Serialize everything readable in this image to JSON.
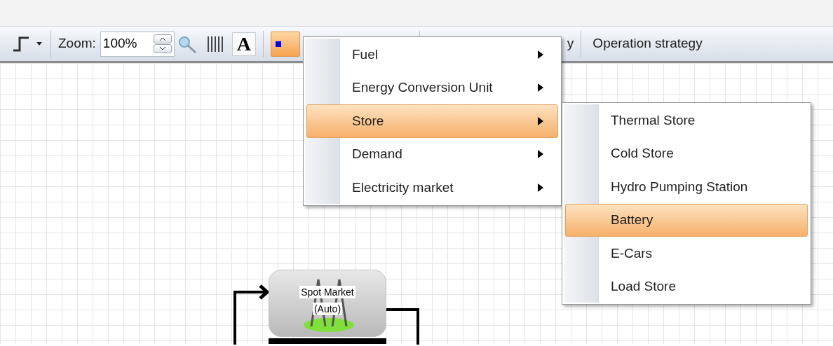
{
  "toolbar": {
    "zoom_label": "Zoom:",
    "zoom_value": "100%",
    "font_button": "A",
    "color_button_active": true,
    "partial_item": "y",
    "operation_strategy": "Operation strategy"
  },
  "menu": {
    "items": [
      {
        "label": "Fuel",
        "selected": false,
        "has_submenu": true
      },
      {
        "label": "Energy Conversion Unit",
        "selected": false,
        "has_submenu": true
      },
      {
        "label": "Store",
        "selected": true,
        "has_submenu": true
      },
      {
        "label": "Demand",
        "selected": false,
        "has_submenu": true
      },
      {
        "label": "Electricity market",
        "selected": false,
        "has_submenu": true
      }
    ]
  },
  "submenu": {
    "items": [
      {
        "label": "Thermal Store",
        "selected": false
      },
      {
        "label": "Cold Store",
        "selected": false
      },
      {
        "label": "Hydro Pumping Station",
        "selected": false
      },
      {
        "label": "Battery",
        "selected": true
      },
      {
        "label": "E-Cars",
        "selected": false
      },
      {
        "label": "Load Store",
        "selected": false
      }
    ]
  },
  "canvas": {
    "nodes": [
      {
        "label": "Spot Market",
        "sublabel": "(Auto)"
      }
    ]
  }
}
